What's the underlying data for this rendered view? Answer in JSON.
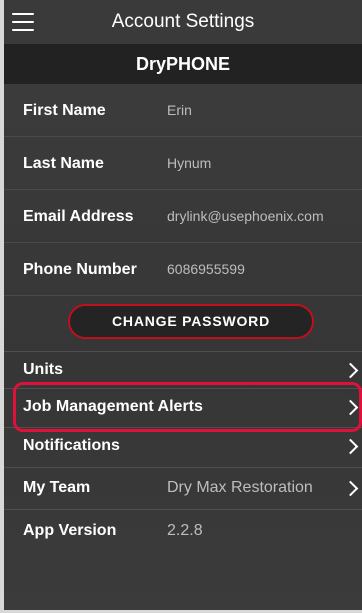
{
  "header": {
    "title": "Account Settings",
    "menu_icon": "hamburger-menu-icon"
  },
  "app_name": "DryPHONE",
  "profile": [
    {
      "label": "First Name",
      "value": "Erin"
    },
    {
      "label": "Last Name",
      "value": "Hynum"
    },
    {
      "label": "Email Address",
      "value": "drylink@usephoenix.com"
    },
    {
      "label": "Phone Number",
      "value": "6086955599"
    }
  ],
  "change_password_label": "CHANGE PASSWORD",
  "nav_items": [
    {
      "label": "Units",
      "value": "",
      "chevron": true
    },
    {
      "label": "Job Management Alerts",
      "value": "",
      "chevron": true
    },
    {
      "label": "Notifications",
      "value": "",
      "chevron": true
    },
    {
      "label": "My Team",
      "value": "Dry Max Restoration",
      "chevron": true
    },
    {
      "label": "App Version",
      "value": "2.2.8",
      "chevron": false
    }
  ],
  "colors": {
    "accent": "#c0101e",
    "highlight": "#e0103a",
    "background": "#3a3a3a",
    "subbar": "#222222"
  }
}
